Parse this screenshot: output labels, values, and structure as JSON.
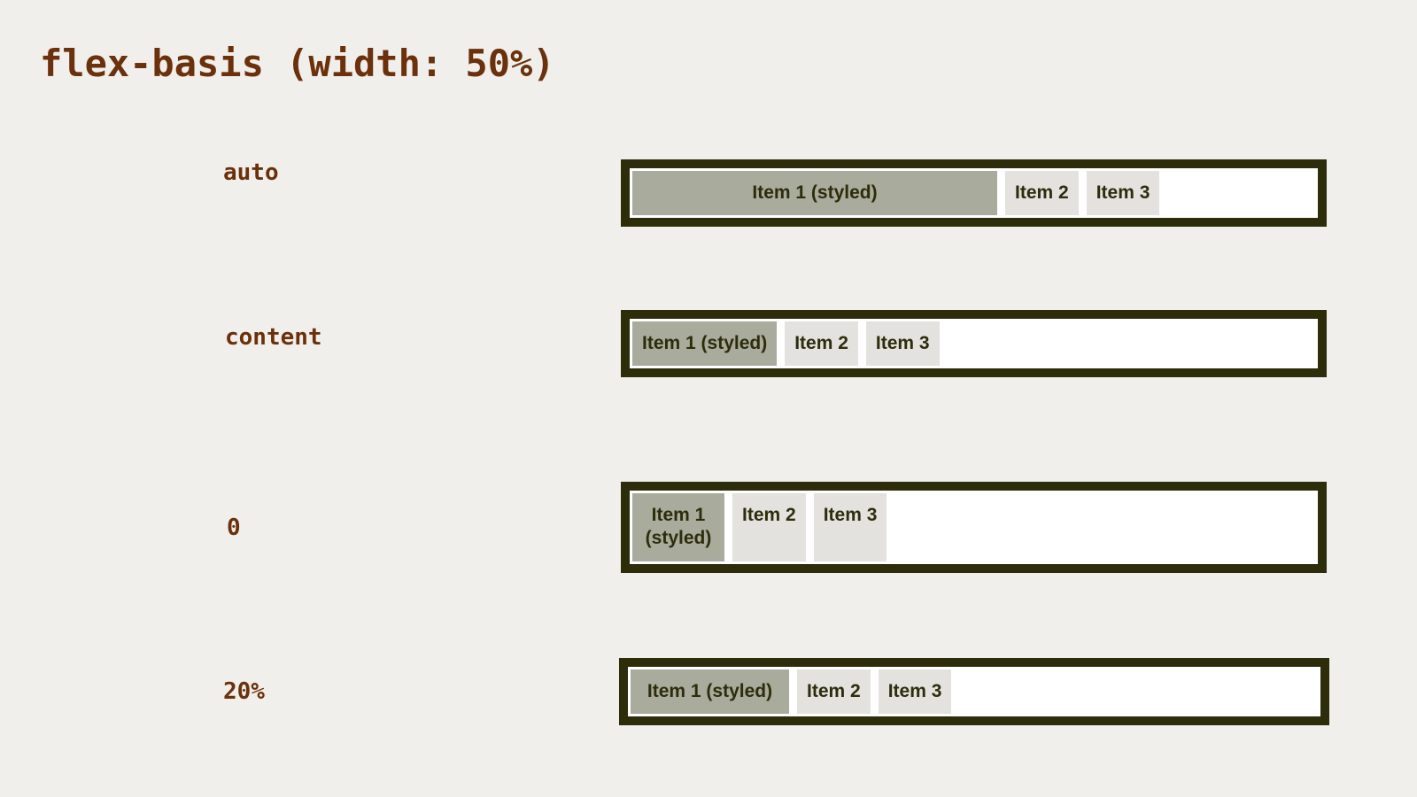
{
  "title": "flex-basis (width: 50%)",
  "rows": [
    {
      "label": "auto",
      "items": [
        "Item 1 (styled)",
        "Item 2",
        "Item 3"
      ]
    },
    {
      "label": "content",
      "items": [
        "Item 1 (styled)",
        "Item 2",
        "Item 3"
      ]
    },
    {
      "label": "0",
      "items": [
        "Item 1 (styled)",
        "Item 2",
        "Item 3"
      ]
    },
    {
      "label": "20%",
      "items": [
        "Item 1 (styled)",
        "Item 2",
        "Item 3"
      ]
    }
  ],
  "colors": {
    "background": "#f1efeb",
    "heading": "#6b300c",
    "container_border": "#2d2d0c",
    "container_fill": "#ffffff",
    "styled_item": "#a9ab9c",
    "plain_item": "#e3e2de",
    "item_text": "#2d2d0c"
  }
}
